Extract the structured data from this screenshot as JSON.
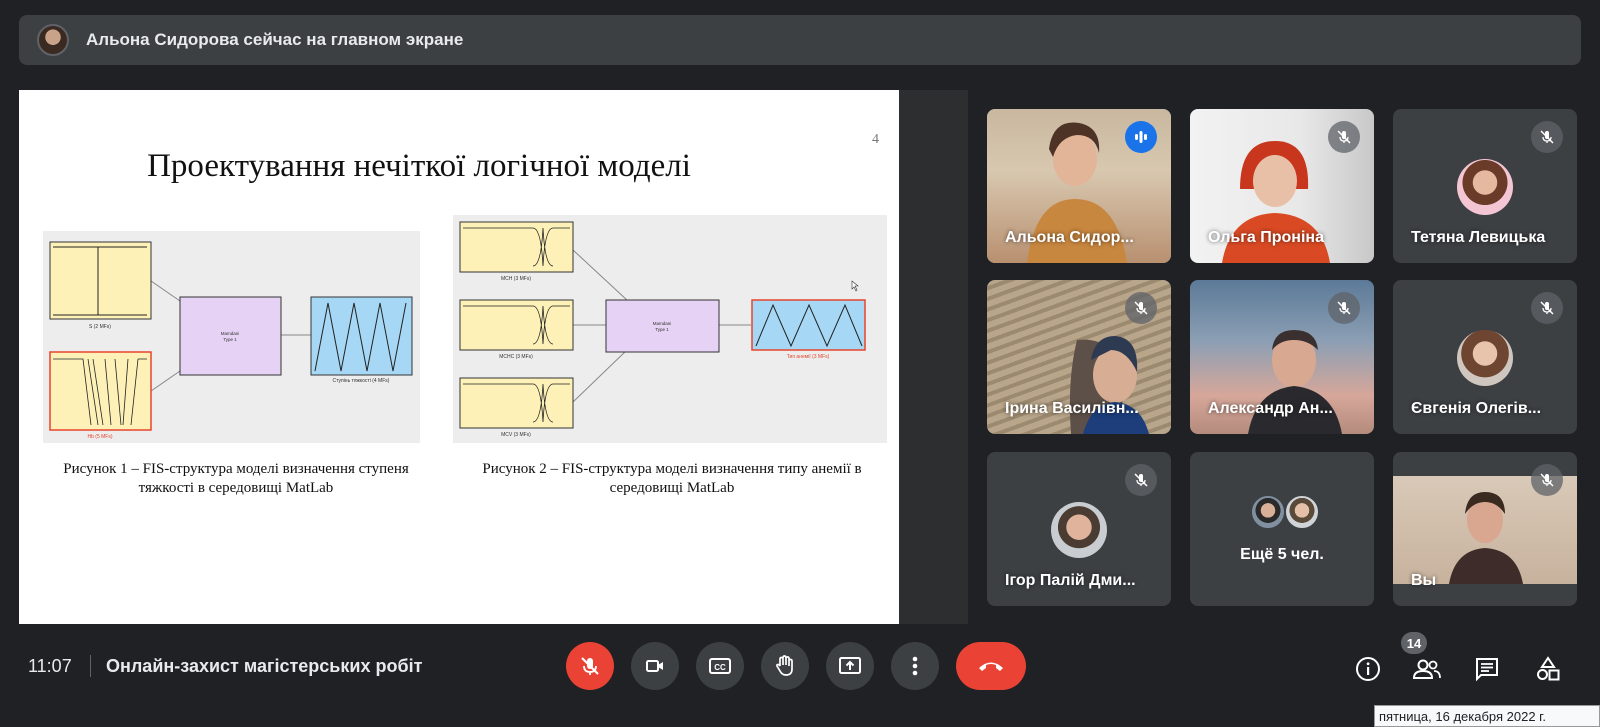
{
  "banner": {
    "text": "Альона Сидорова сейчас на главном экране"
  },
  "slide": {
    "number": "4",
    "title": "Проектування нечіткої логічної моделі",
    "figure1": {
      "caption": "Рисунок 1 – FIS-структура моделі визначення ступеня тяжкості в середовищі MatLab",
      "inputs": [
        "S (2 MFs)",
        "Hb (5 MFs)"
      ],
      "engine": [
        "Mamdani",
        "Type 1"
      ],
      "output": "Ступінь тяжкості (4 MFs)"
    },
    "figure2": {
      "caption": "Рисунок 2 – FIS-структура моделі визначення типу анемії в середовищі MatLab",
      "inputs": [
        "MCH (3 MFs)",
        "MCHC (3 MFs)",
        "MCV (3 MFs)"
      ],
      "engine": [
        "Mamdani",
        "Type 1"
      ],
      "output": "Тип анемії (3 MFs)"
    }
  },
  "participants": [
    {
      "name": "Альона Сидор...",
      "mic": "speaking"
    },
    {
      "name": "Ольга Проніна",
      "mic": "muted"
    },
    {
      "name": "Тетяна Левицька",
      "mic": "muted"
    },
    {
      "name": "Ірина Василівн...",
      "mic": "muted"
    },
    {
      "name": "Александр Ан...",
      "mic": "muted"
    },
    {
      "name": "Євгенія Олегів...",
      "mic": "muted"
    },
    {
      "name": "Ігор Палій Дми...",
      "mic": "muted"
    },
    {
      "name": "Ещё 5 чел.",
      "mic": "none"
    },
    {
      "name": "Вы",
      "mic": "muted"
    }
  ],
  "bottom": {
    "time": "11:07",
    "meeting_title": "Онлайн-захист магістерських робіт",
    "participants_count": "14",
    "tooltip": "пятница, 16 декабря 2022 г."
  },
  "colors": {
    "accent": "#8ab4f8",
    "danger": "#ea4335",
    "speaking": "#1a73e8",
    "bg": "#202124",
    "tile": "#3c4043"
  }
}
